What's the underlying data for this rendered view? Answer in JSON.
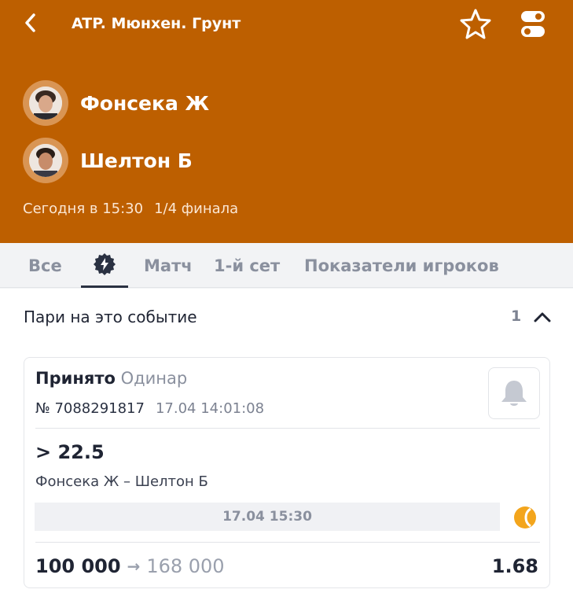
{
  "header": {
    "title": "ATP. Мюнхен. Грунт",
    "colors": {
      "background": "#bd5f00"
    }
  },
  "players": [
    {
      "name": "Фонсека Ж",
      "avatar": "player-photo"
    },
    {
      "name": "Шелтон Б",
      "avatar": "player-photo"
    }
  ],
  "match": {
    "time": "Сегодня в 15:30",
    "stage": "1/4 финала"
  },
  "tabs": [
    {
      "label": "Все"
    },
    {
      "label": "",
      "icon": "bolt-icon",
      "active": true
    },
    {
      "label": "Матч"
    },
    {
      "label": "1-й сет"
    },
    {
      "label": "Показатели игроков"
    }
  ],
  "bets_section": {
    "title": "Пари на это событие",
    "count": "1",
    "bet": {
      "status": "Принято",
      "type": "Одинар",
      "number": "№ 7088291817",
      "datetime": "17.04 14:01:08",
      "outcome": "> 22.5",
      "event": "Фонсека Ж – Шелтон Б",
      "event_time": "17.04 15:30",
      "stake": "100 000",
      "arrow": "→",
      "potential_win": "168 000",
      "odds": "1.68"
    }
  }
}
